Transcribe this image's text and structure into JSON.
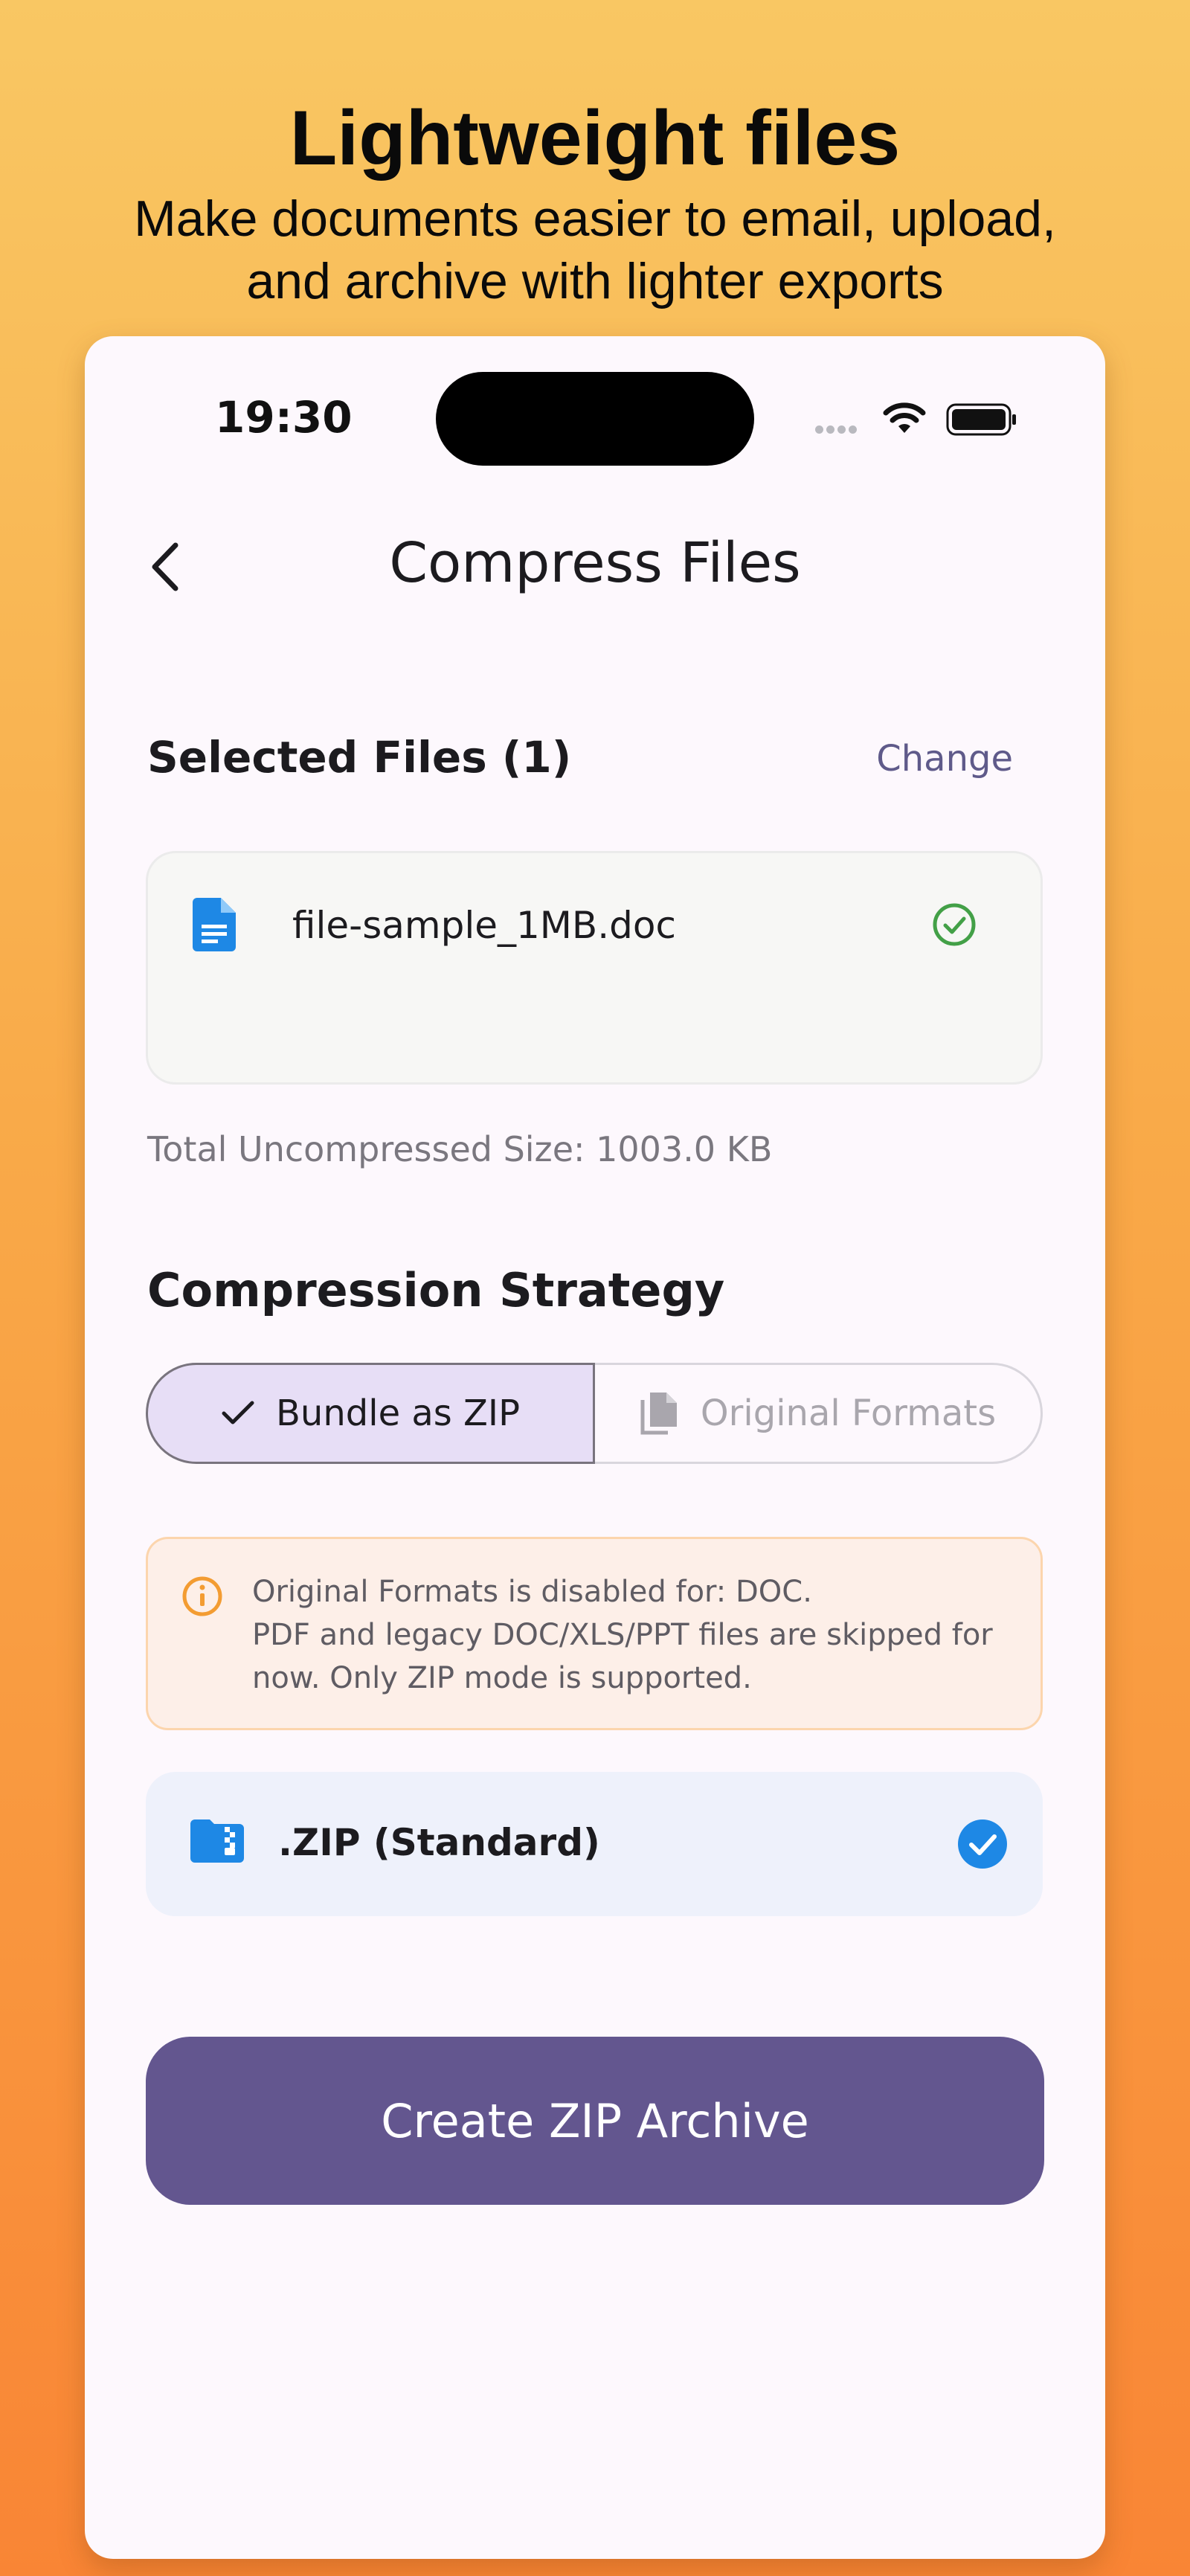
{
  "promo": {
    "title": "Lightweight files",
    "subtitle_line1": "Make documents easier to email, upload,",
    "subtitle_line2": "and archive with lighter exports"
  },
  "status_bar": {
    "time": "19:30",
    "icons": [
      "signal-dots-icon",
      "wifi-icon",
      "battery-icon"
    ]
  },
  "header": {
    "back_icon": "chevron-left-icon",
    "title": "Compress Files"
  },
  "selected_files": {
    "heading": "Selected Files (1)",
    "change_label": "Change",
    "files": [
      {
        "name": "file-sample_1MB.doc",
        "icon": "document-icon",
        "status_icon": "check-circle-icon",
        "status_color": "#43a047"
      }
    ],
    "total_size": "Total Uncompressed Size: 1003.0 KB"
  },
  "strategy": {
    "heading": "Compression Strategy",
    "options": [
      {
        "label": "Bundle as ZIP",
        "icon": "check-icon",
        "selected": true
      },
      {
        "label": "Original Formats",
        "icon": "copy-files-icon",
        "selected": false
      }
    ]
  },
  "warning": {
    "icon": "info-icon",
    "lines": [
      "Original Formats is disabled for: DOC.",
      "PDF and legacy DOC/XLS/PPT files are skipped for",
      "now. Only ZIP mode is supported."
    ]
  },
  "format": {
    "label": ".ZIP (Standard)",
    "icon": "zip-folder-icon",
    "selected_icon": "check-filled-circle-icon"
  },
  "cta": {
    "label": "Create ZIP Archive"
  },
  "colors": {
    "accent": "#63568f",
    "selected_segment": "#e7def6",
    "blue_icon": "#1e88e5",
    "warning_orange": "#f39c32",
    "success_green": "#43a047"
  }
}
